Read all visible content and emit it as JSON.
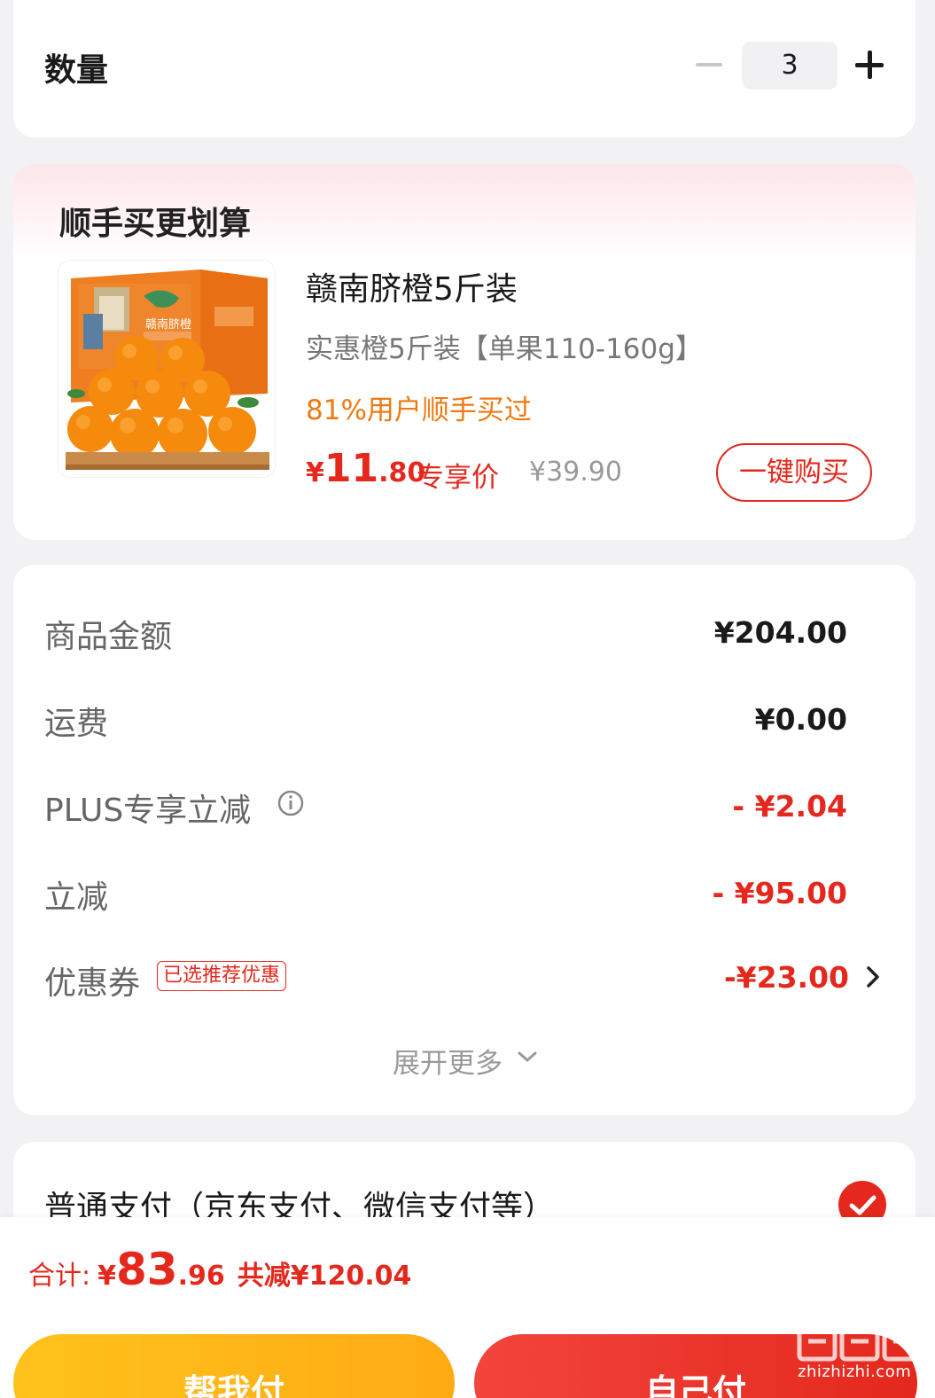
{
  "quantity": {
    "label": "数量",
    "value": "3"
  },
  "upsell": {
    "title": "顺手买更划算",
    "product": {
      "name": "赣南脐橙5斤装",
      "spec": "实惠橙5斤装【单果110-160g】",
      "tag": "81%用户顺手买过",
      "price_symbol": "¥",
      "price_int": "11",
      "price_dec": ".80",
      "price_tag": "专享价",
      "original_price": "¥39.90",
      "buy_button": "一键购买",
      "box_label": "赣南脐橙"
    }
  },
  "breakdown": {
    "rows": [
      {
        "label": "商品金额",
        "value": "¥204.00"
      },
      {
        "label": "运费",
        "value": "¥0.00"
      },
      {
        "label": "PLUS专享立减",
        "value": "- ¥2.04"
      },
      {
        "label": "立减",
        "value": "- ¥95.00"
      },
      {
        "label": "优惠券",
        "value": "-¥23.00",
        "badge": "已选推荐优惠"
      }
    ],
    "expand_more": "展开更多"
  },
  "payment": {
    "label": "普通支付（京东支付、微信支付等）",
    "selected": true
  },
  "bottom": {
    "total_label": "合计:",
    "total_symbol": "¥",
    "total_int": "83",
    "total_dec": ".96",
    "saved": "共减¥120.04",
    "help_pay": "帮我付",
    "self_pay": "自己付"
  },
  "watermark": {
    "text": "zhizhizhi.com"
  },
  "colors": {
    "accent_red": "#e4281d",
    "accent_orange": "#ee7a14",
    "help_button": "#ffb81a"
  }
}
